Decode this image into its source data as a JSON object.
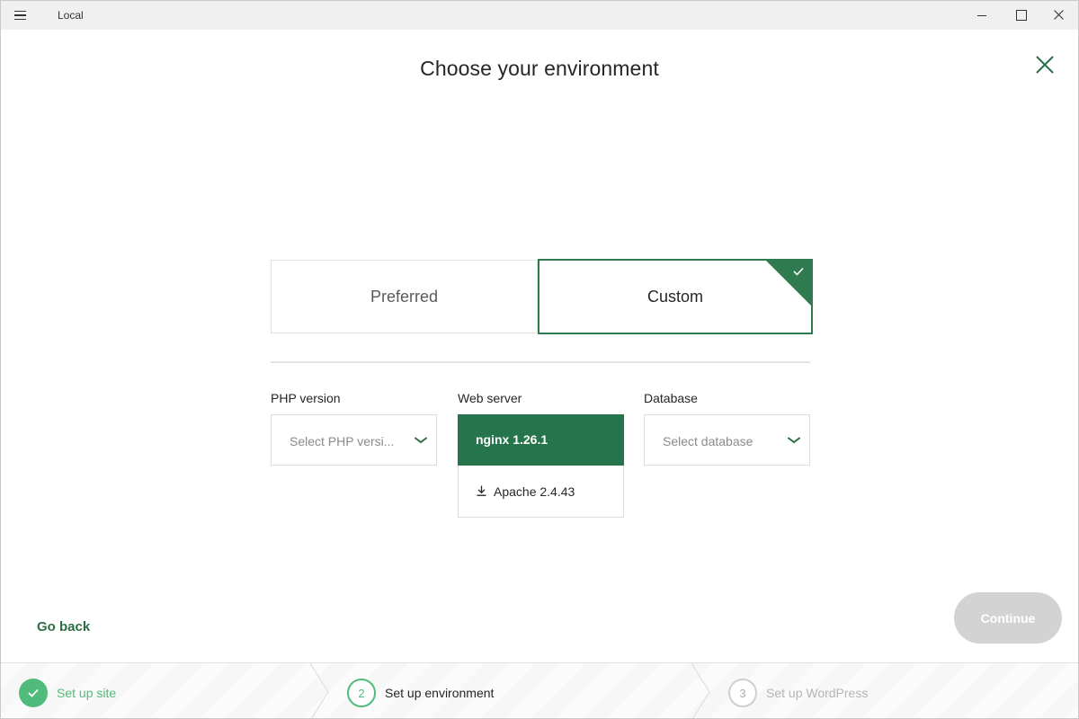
{
  "window": {
    "title": "Local"
  },
  "page": {
    "title": "Choose your environment"
  },
  "environment_options": {
    "preferred_label": "Preferred",
    "custom_label": "Custom",
    "selected": "Custom"
  },
  "fields": {
    "php": {
      "label": "PHP version",
      "placeholder": "Select PHP versi..."
    },
    "web_server": {
      "label": "Web server",
      "selected": "nginx 1.26.1",
      "options": [
        "Apache 2.4.43"
      ]
    },
    "database": {
      "label": "Database",
      "placeholder": "Select database"
    }
  },
  "actions": {
    "go_back": "Go back",
    "continue": "Continue"
  },
  "stepper": {
    "steps": [
      {
        "number": "1",
        "label": "Set up site",
        "state": "complete"
      },
      {
        "number": "2",
        "label": "Set up environment",
        "state": "current"
      },
      {
        "number": "3",
        "label": "Set up WordPress",
        "state": "upcoming"
      }
    ]
  },
  "colors": {
    "brand_green": "#25744b",
    "step_green": "#51bb7b",
    "disabled_button": "#d3d3d3"
  }
}
